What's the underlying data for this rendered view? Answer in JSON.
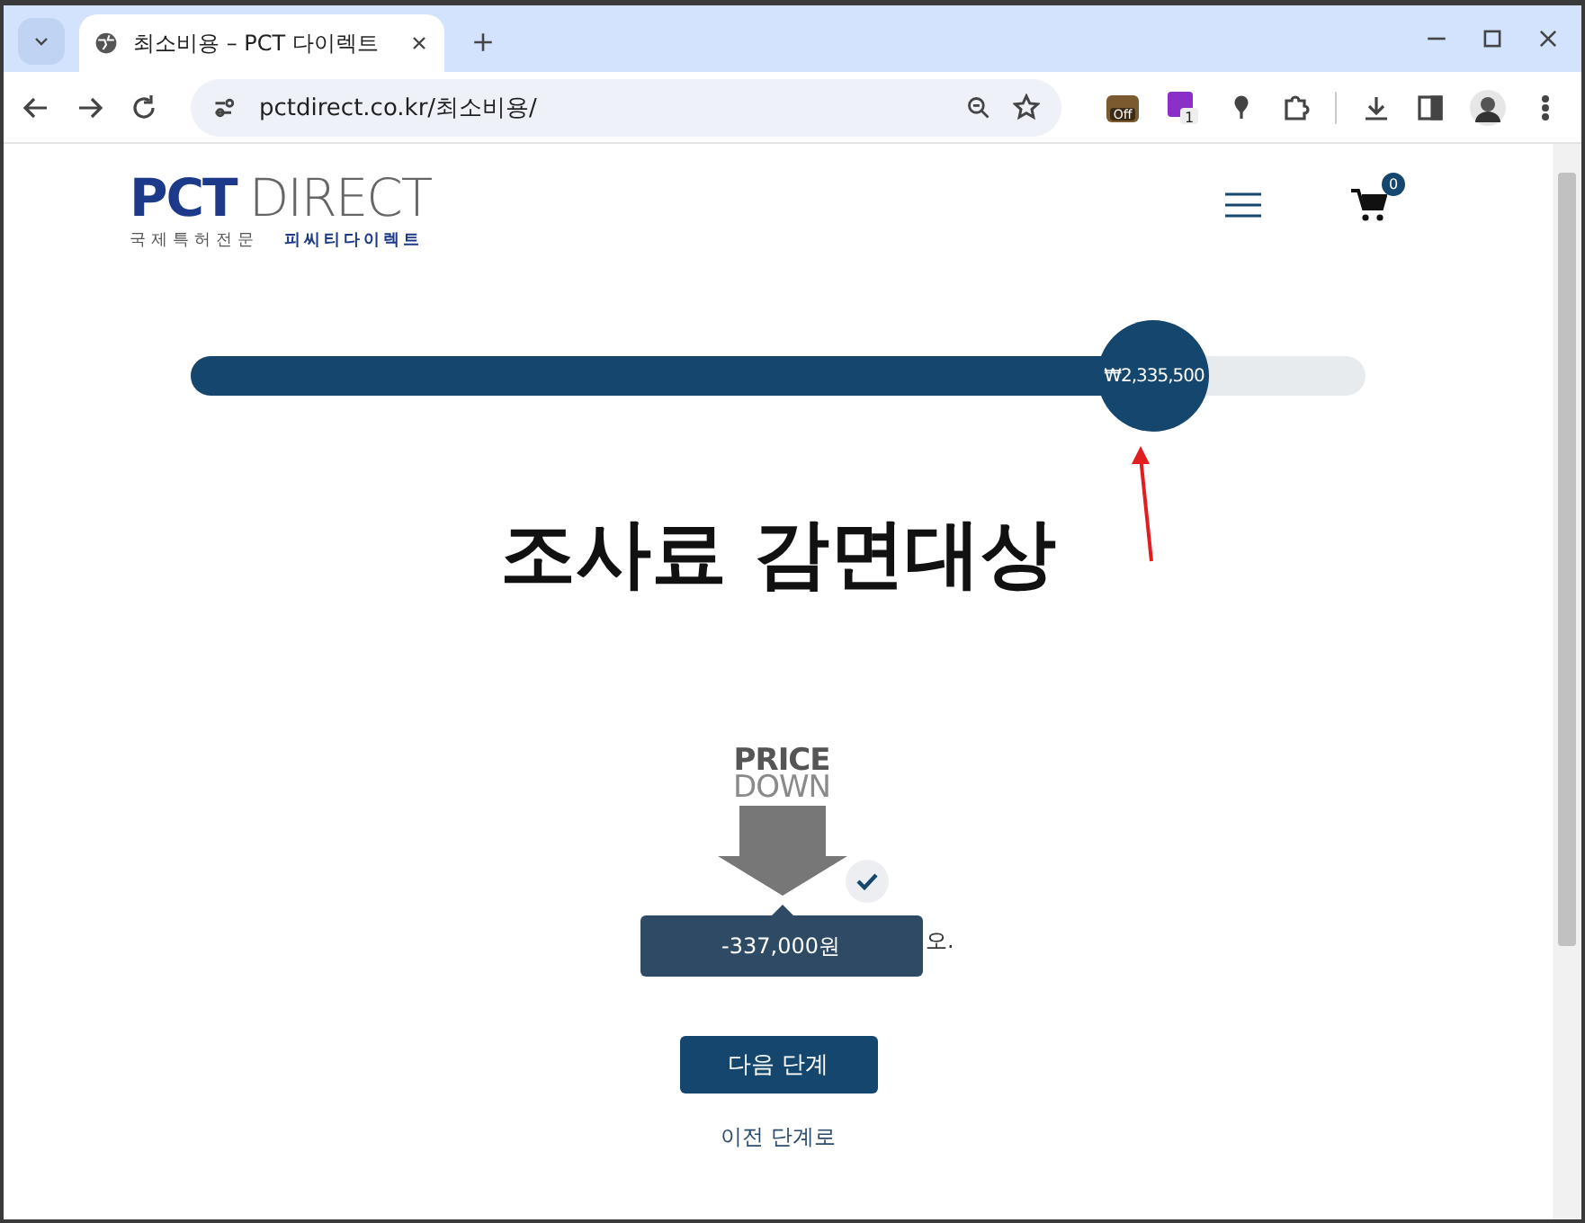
{
  "browser": {
    "tab": {
      "title": "최소비용 – PCT 다이렉트",
      "selected": true
    },
    "address": "pctdirect.co.kr/최소비용/",
    "extensions": [
      {
        "label": "Off"
      },
      {
        "label": "1"
      }
    ]
  },
  "header": {
    "logo": {
      "brand_bold": "PCT",
      "brand_light": "DIRECT",
      "tagline_left": "국제특허전문",
      "tagline_right": "피씨티다이렉트"
    },
    "cart_count": "0"
  },
  "price_slider": {
    "level": 0.82,
    "reading": "₩2,335,500"
  },
  "heading": "조사료 감면대상",
  "discount": {
    "badge_top": "PRICE",
    "badge_bottom": "DOWN",
    "checked": true,
    "tooltip": "-337,000원",
    "covered_text_end": "오."
  },
  "buttons": {
    "next": "다음 단계",
    "back": "이전 단계로"
  }
}
